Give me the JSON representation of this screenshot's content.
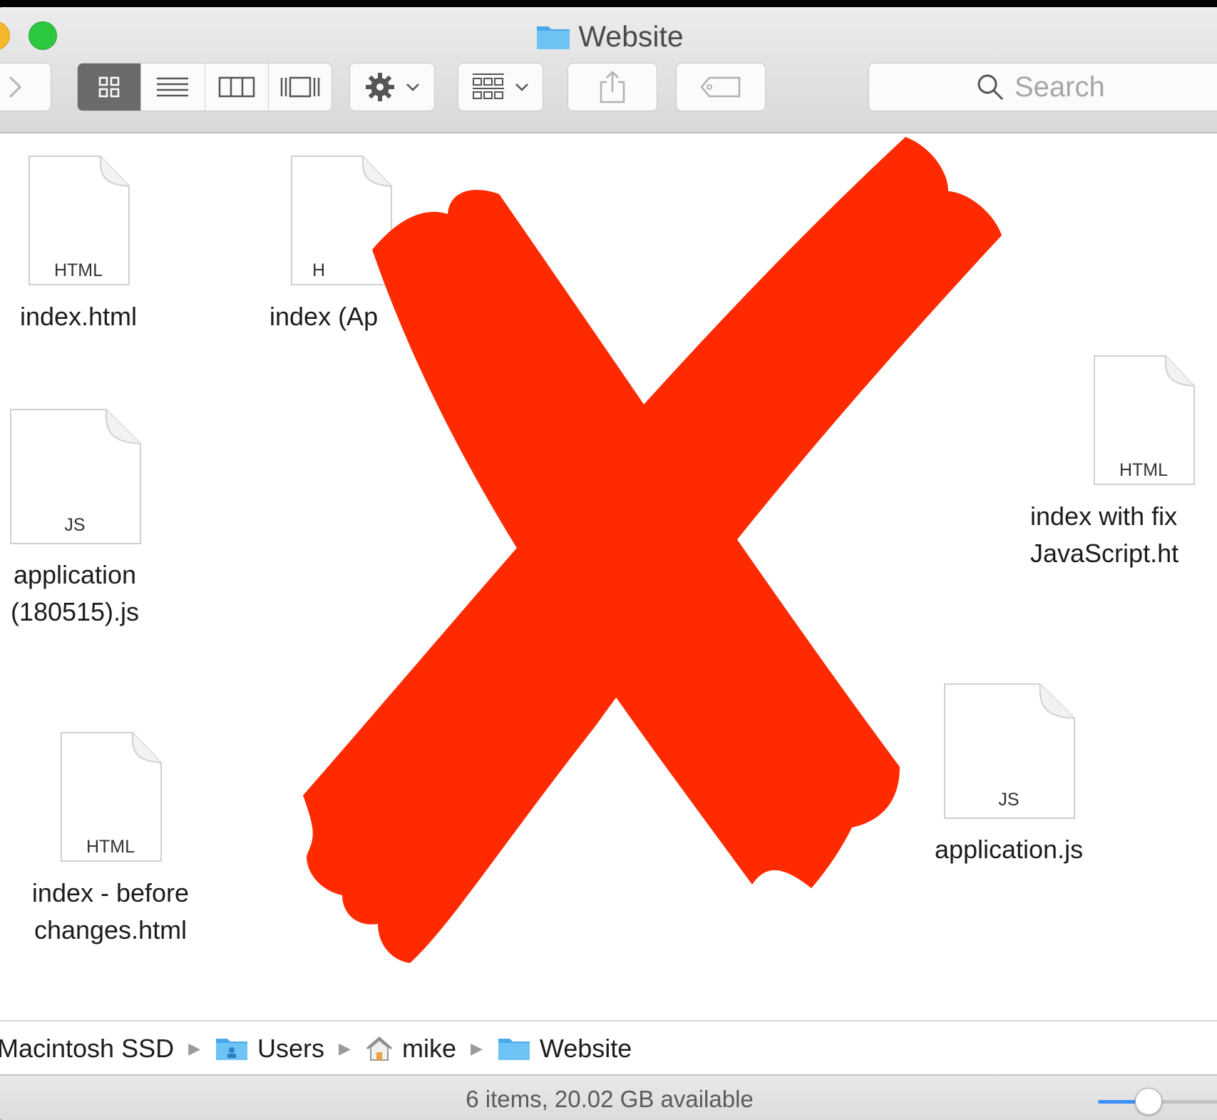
{
  "window": {
    "title": "Website"
  },
  "toolbar": {
    "view_modes": [
      "icon-view",
      "list-view",
      "column-view",
      "cover-flow-view"
    ],
    "active_view": "icon-view",
    "search_placeholder": "Search"
  },
  "files": [
    {
      "name": "index.html",
      "type_badge": "HTML"
    },
    {
      "name": "index (Ap",
      "type_badge": "H"
    },
    {
      "name": "index with fix\nJavaScript.ht",
      "type_badge": "HTML"
    },
    {
      "name": "application\n(180515).js",
      "type_badge": "JS"
    },
    {
      "name": "application.js",
      "type_badge": "JS"
    },
    {
      "name": "index - before\nchanges.html",
      "type_badge": "HTML"
    }
  ],
  "pathbar": {
    "items": [
      "Macintosh SSD",
      "Users",
      "mike",
      "Website"
    ]
  },
  "status": {
    "text": "6 items, 20.02 GB available"
  },
  "icon_size_slider": {
    "value_fraction": 0.35
  },
  "colors": {
    "overlay_x": "#ff2a00",
    "folder_blue": "#5ab8f0",
    "green_light": "#2bc840",
    "yellow_light": "#f5b82c",
    "accent": "#3b8ff5"
  }
}
